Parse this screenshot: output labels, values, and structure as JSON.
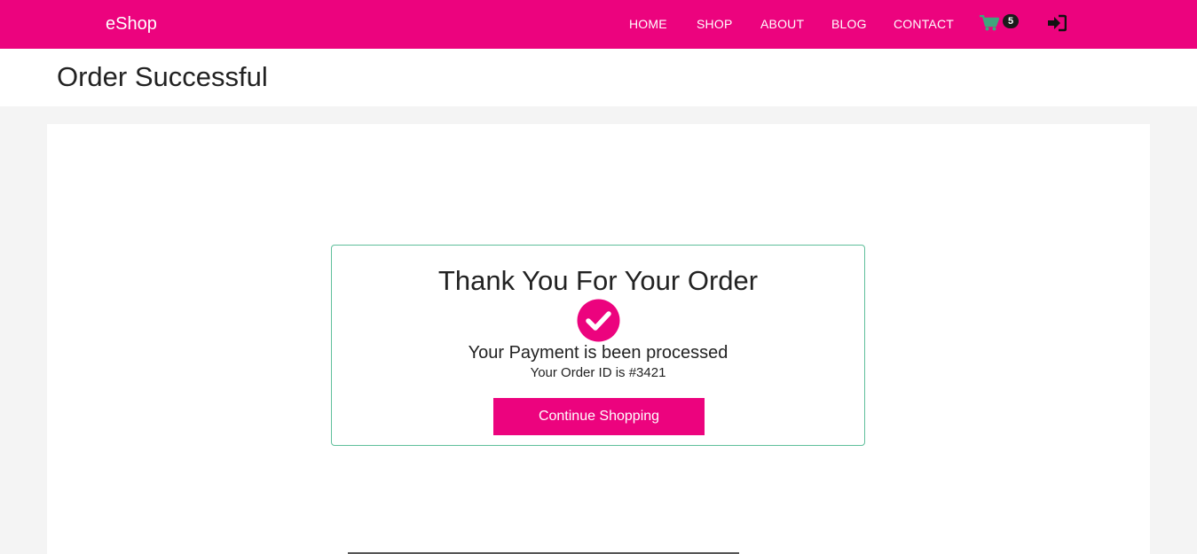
{
  "header": {
    "brand": "eShop",
    "nav": [
      {
        "label": "HOME"
      },
      {
        "label": "SHOP"
      },
      {
        "label": "ABOUT"
      },
      {
        "label": "BLOG"
      },
      {
        "label": "CONTACT"
      }
    ],
    "cart": {
      "icon": "cart-icon",
      "count": "5",
      "icon_color": "#3fa57c"
    },
    "login_icon": "sign-in-icon"
  },
  "page": {
    "title": "Order Successful"
  },
  "confirmation": {
    "heading": "Thank You For Your Order",
    "icon": "check-circle-icon",
    "payment_message": "Your Payment is been processed",
    "order_id_text": "Your Order ID is #3421",
    "continue_label": "Continue Shopping"
  },
  "colors": {
    "brand": "#ec037e",
    "card_border": "#5fbf9b",
    "background": "#f4f4f4"
  }
}
